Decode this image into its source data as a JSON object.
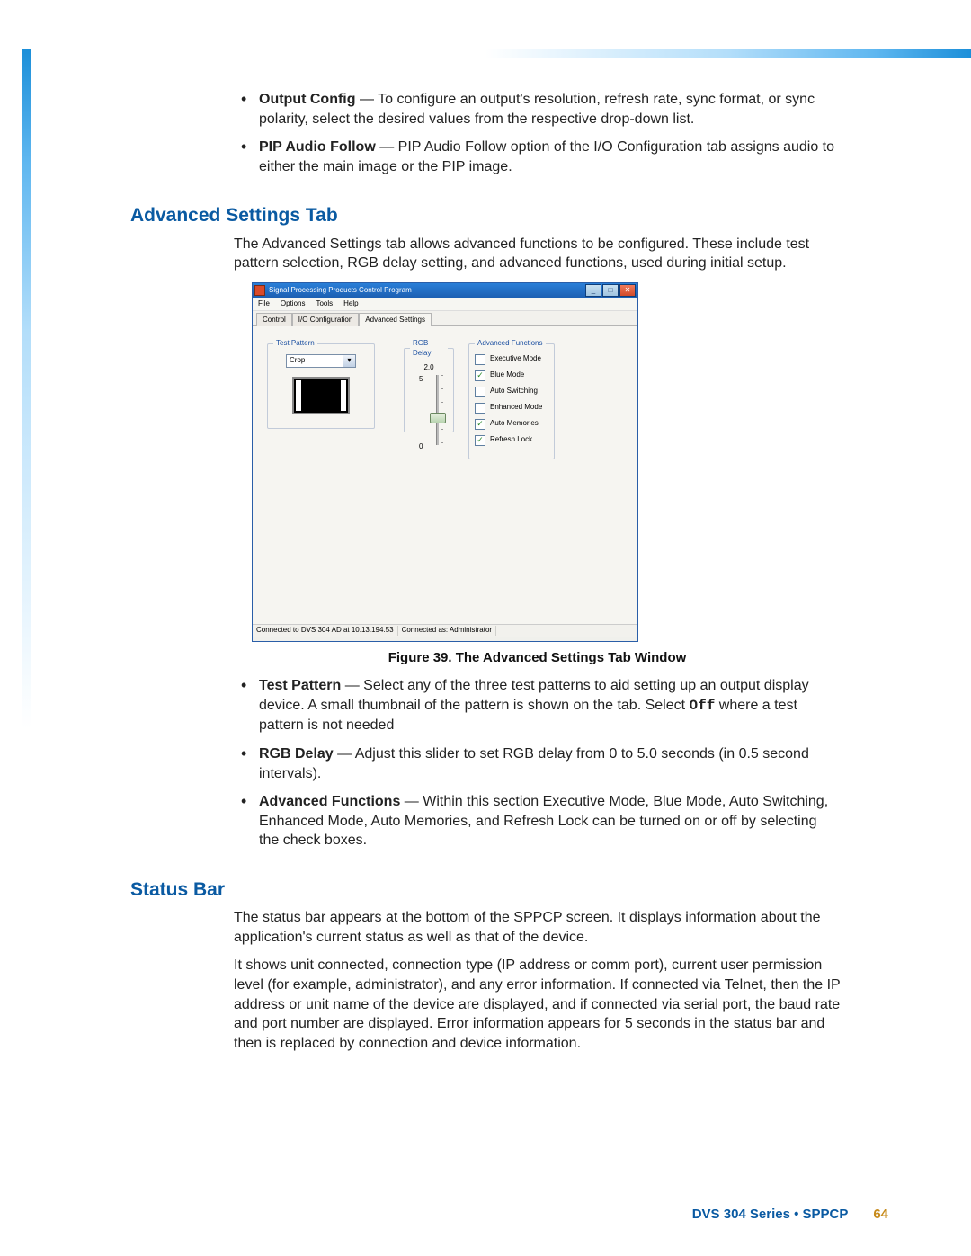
{
  "intro_bullets": [
    {
      "title": "Output Config",
      "text": " — To configure an output's resolution, refresh rate, sync format, or sync polarity, select the desired values from the respective drop-down list."
    },
    {
      "title": "PIP Audio Follow",
      "text": " — PIP Audio Follow option of the I/O Configuration tab assigns audio to either the main image or the PIP image."
    }
  ],
  "sections": {
    "advanced_heading": "Advanced Settings Tab",
    "advanced_para": "The Advanced Settings tab allows advanced functions to be configured. These include test pattern selection, RGB delay setting, and advanced functions, used during initial setup.",
    "status_heading": "Status Bar",
    "status_para_1": "The status bar appears at the bottom of the SPPCP screen. It displays information about the application's current status as well as that of the device.",
    "status_para_2": "It shows unit connected, connection type (IP address or comm port), current user permission level (for example, administrator), and any error information. If connected via Telnet, then the IP address or unit name of the device are displayed, and if connected via serial port, the baud rate and port number are displayed. Error information appears for 5 seconds in the status bar and then is replaced by connection and device information."
  },
  "app": {
    "title": "Signal Processing Products Control Program",
    "menu": [
      "File",
      "Options",
      "Tools",
      "Help"
    ],
    "tabs": [
      "Control",
      "I/O Configuration",
      "Advanced Settings"
    ],
    "active_tab_index": 2,
    "test_pattern": {
      "legend": "Test Pattern",
      "value": "Crop"
    },
    "rgb_delay": {
      "legend": "RGB Delay",
      "value": "2.0",
      "max": "5",
      "min": "0"
    },
    "functions": {
      "legend": "Advanced Functions",
      "items": [
        {
          "label": "Executive Mode",
          "checked": false
        },
        {
          "label": "Blue Mode",
          "checked": true
        },
        {
          "label": "Auto Switching",
          "checked": false
        },
        {
          "label": "Enhanced Mode",
          "checked": false
        },
        {
          "label": "Auto Memories",
          "checked": true
        },
        {
          "label": "Refresh Lock",
          "checked": true
        }
      ]
    },
    "status": {
      "conn": "Connected to DVS 304 AD at 10.13.194.53",
      "user": "Connected as: Administrator"
    }
  },
  "figure_caption": "Figure 39. The Advanced Settings Tab Window",
  "post_bullets": [
    {
      "title": "Test Pattern",
      "pre": " — Select any of the three test patterns to aid setting up an output display device. A small thumbnail of the pattern is shown on the tab. Select ",
      "off": "Off",
      "post": " where a test pattern is not needed"
    },
    {
      "title": "RGB Delay",
      "text": " — Adjust this slider to set RGB delay from 0 to 5.0 seconds (in 0.5 second intervals)."
    },
    {
      "title": "Advanced Functions",
      "text": " — Within this section Executive Mode, Blue Mode, Auto Switching, Enhanced Mode, Auto Memories, and Refresh Lock can be turned on or off by selecting the check boxes."
    }
  ],
  "footer": {
    "text": "DVS 304 Series • SPPCP",
    "page": "64"
  }
}
